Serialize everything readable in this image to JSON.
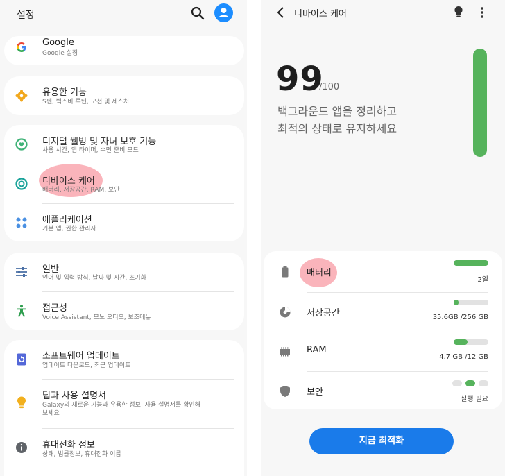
{
  "left": {
    "header": {
      "title": "설정"
    },
    "items": {
      "google": {
        "title": "Google",
        "subtitle": "Google 설정"
      },
      "useful": {
        "title": "유용한 기능",
        "subtitle": "S펜, 빅스비 루틴, 모션 및 제스처"
      },
      "digital": {
        "title": "디지털 웰빙 및 자녀 보호 기능",
        "subtitle": "사용 시간, 앱 타이머, 수면 준비 모드"
      },
      "device_care": {
        "title": "디바이스 케어",
        "subtitle": "배터리, 저장공간, RAM, 보안"
      },
      "apps": {
        "title": "애플리케이션",
        "subtitle": "기본 앱, 권한 관리자"
      },
      "general": {
        "title": "일반",
        "subtitle": "언어 및 입력 방식, 날짜 및 시간, 초기화"
      },
      "accessibility": {
        "title": "접근성",
        "subtitle": "Voice Assistant, 모노 오디오, 보조메뉴"
      },
      "software": {
        "title": "소프트웨어 업데이트",
        "subtitle": "업데이트 다운로드, 최근 업데이트"
      },
      "tips": {
        "title": "팁과 사용 설명서",
        "subtitle_line1": "Galaxy의 새로운 기능과 유용한 정보, 사용 설명서를 확인해",
        "subtitle_line2": "보세요"
      },
      "phone_info": {
        "title": "휴대전화 정보",
        "subtitle": "상태, 법률정보, 휴대전화 이름"
      }
    }
  },
  "right": {
    "header": {
      "title": "디바이스 케어"
    },
    "score": {
      "value": "99",
      "max": "/100"
    },
    "headline": {
      "line1": "백그라운드 앱을 정리하고",
      "line2": "최적의 상태로 유지하세요"
    },
    "score_fraction": 0.99,
    "rows": {
      "battery": {
        "label": "배터리",
        "value": "2일",
        "fill": 1.0
      },
      "storage": {
        "label": "저장공간",
        "value": "35.6GB /256 GB",
        "fill": 0.14
      },
      "ram": {
        "label": "RAM",
        "value": "4.7 GB /12 GB",
        "fill": 0.4
      },
      "security": {
        "label": "보안",
        "value": "실행 필요"
      }
    },
    "optimize_button": "지금 최적화"
  },
  "colors": {
    "accent": "#1a7bea",
    "good": "#56b35c",
    "highlight": "#f88c96"
  }
}
